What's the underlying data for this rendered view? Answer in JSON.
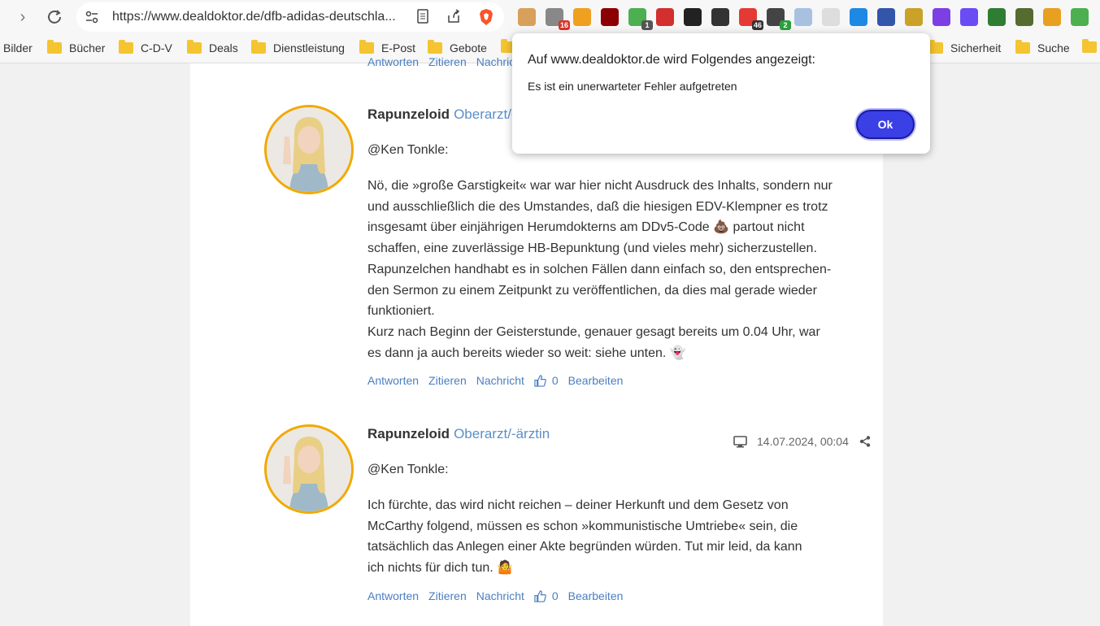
{
  "browser": {
    "url": "https://www.dealdoktor.de/dfb-adidas-deutschla...",
    "extensions": [
      {
        "icon": "cookie-icon",
        "color": "#d9a05b"
      },
      {
        "icon": "badge-ext-icon",
        "color": "#888888",
        "badge": "16",
        "badge_color": "#d9342b"
      },
      {
        "icon": "trash-icon",
        "color": "#f0a020"
      },
      {
        "icon": "ublock-icon",
        "color": "#8b0000"
      },
      {
        "icon": "shield-ext-icon",
        "color": "#4caf50",
        "badge": "1",
        "badge_color": "#555555"
      },
      {
        "icon": "red-ext-icon",
        "color": "#d32f2f"
      },
      {
        "icon": "black-ext-icon",
        "color": "#222222"
      },
      {
        "icon": "stop-icon",
        "color": "#333333"
      },
      {
        "icon": "red-square-icon",
        "color": "#e53935",
        "badge": "46",
        "badge_color": "#333333"
      },
      {
        "icon": "dark-ext-icon",
        "color": "#444444",
        "badge": "2",
        "badge_color": "#2e9e3e"
      },
      {
        "icon": "r-ext-icon",
        "color": "#a8c1e0"
      },
      {
        "icon": "page-ext-icon",
        "color": "#dddddd"
      },
      {
        "icon": "blue-s-icon",
        "color": "#1e88e5"
      },
      {
        "icon": "save-icon",
        "color": "#3355aa"
      },
      {
        "icon": "globe-ext-icon",
        "color": "#c9a227"
      },
      {
        "icon": "firefox-icon",
        "color": "#7b3fe4"
      },
      {
        "icon": "purple-arrow-icon",
        "color": "#6a4cf5"
      },
      {
        "icon": "green-arrow-icon",
        "color": "#2e7d32"
      },
      {
        "icon": "gradient-ext-icon",
        "color": "#556b2f"
      },
      {
        "icon": "person-check-icon",
        "color": "#e8a020"
      },
      {
        "icon": "multicolor-ext-icon",
        "color": "#4caf50"
      }
    ]
  },
  "bookmarks": [
    "Bilder",
    "Bücher",
    "C-D-V",
    "Deals",
    "Dienstleistung",
    "E-Post",
    "Gebote",
    "Sicherheit",
    "Suche"
  ],
  "page": {
    "top_links": [
      "Antworten",
      "Zitieren",
      "Nachricht"
    ],
    "comments": [
      {
        "author": "Rapunzeloid",
        "rank": "Oberarzt/-",
        "mention": "@Ken Tonkle:",
        "body": [
          "Nö, die »große Garstigkeit« war war hier nicht Ausdruck des Inhalts, sondern nur",
          "und ausschließlich die des Umstandes, daß die hiesigen EDV-Klempner es trotz",
          "insgesamt über einjährigen Herumdokterns am DDv5-Code 💩 partout nicht",
          "schaffen, eine zuverlässige HB-Bepunktung (und vieles mehr) sicherzustellen.",
          "Rapunzelchen handhabt es in solchen Fällen dann einfach so, den entsprechen-",
          "den Sermon zu einem Zeitpunkt zu veröffentlichen, da dies mal gerade wieder",
          "funktioniert.",
          "Kurz nach Beginn der Geisterstunde, genauer gesagt bereits um 0.04 Uhr, war",
          "es dann ja auch bereits wieder so weit: siehe unten. 👻"
        ],
        "actions": {
          "reply": "Antworten",
          "quote": "Zitieren",
          "message": "Nachricht",
          "likes": "0",
          "edit": "Bearbeiten"
        }
      },
      {
        "author": "Rapunzeloid",
        "rank": "Oberarzt/-ärztin",
        "timestamp": "14.07.2024, 00:04",
        "mention": "@Ken Tonkle:",
        "body": [
          "Ich fürchte, das wird nicht reichen – deiner Herkunft und dem Gesetz von",
          "McCarthy folgend, müssen es schon »kommunistische Umtriebe« sein, die",
          "tatsächlich das Anlegen einer Akte begründen würden. Tut mir leid, da kann",
          "ich nichts für dich tun. 🤷"
        ],
        "actions": {
          "reply": "Antworten",
          "quote": "Zitieren",
          "message": "Nachricht",
          "likes": "0",
          "edit": "Bearbeiten"
        }
      }
    ]
  },
  "dialog": {
    "title": "Auf www.dealdoktor.de wird Folgendes angezeigt:",
    "message": "Es ist ein unerwarteter Fehler aufgetreten",
    "ok": "Ok"
  },
  "colors": {
    "accent": "#3b3fe6",
    "link": "#4a7fc1",
    "avatar_border": "#f2a900"
  }
}
